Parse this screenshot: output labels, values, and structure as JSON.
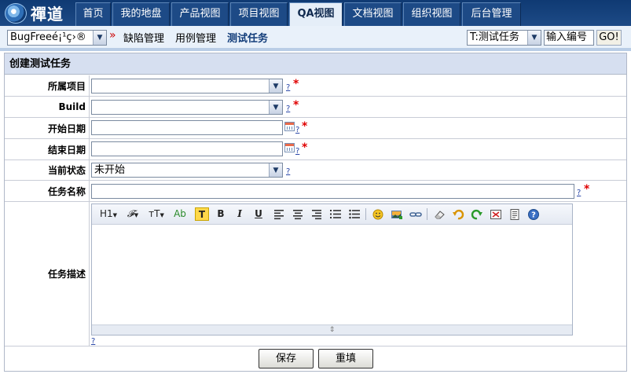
{
  "nav": {
    "logo_text": "禪道",
    "tabs": [
      {
        "label": "首页",
        "active": false
      },
      {
        "label": "我的地盘",
        "active": false
      },
      {
        "label": "产品视图",
        "active": false
      },
      {
        "label": "项目视图",
        "active": false
      },
      {
        "label": "QA视图",
        "active": true
      },
      {
        "label": "文档视图",
        "active": false
      },
      {
        "label": "组织视图",
        "active": false
      },
      {
        "label": "后台管理",
        "active": false
      }
    ]
  },
  "subnav": {
    "product_select": "BugFreeé¡¹ç›®",
    "separator": "»",
    "links": [
      "缺陷管理",
      "用例管理",
      "测试任务"
    ],
    "type_select": "T:测试任务",
    "id_input_value": "输入编号",
    "go_label": "GO!"
  },
  "form": {
    "title": "创建测试任务",
    "fields": {
      "project": {
        "label": "所属项目",
        "value": ""
      },
      "build": {
        "label": "Build",
        "value": ""
      },
      "begin": {
        "label": "开始日期",
        "value": ""
      },
      "end": {
        "label": "结束日期",
        "value": ""
      },
      "status": {
        "label": "当前状态",
        "value": "未开始"
      },
      "name": {
        "label": "任务名称",
        "value": ""
      },
      "desc": {
        "label": "任务描述"
      }
    },
    "help": "?",
    "required": "*",
    "editor_toolbar": [
      "H1",
      "𝓕",
      "тT",
      "Ab",
      "T",
      "B",
      "I",
      "U"
    ],
    "buttons": {
      "save": "保存",
      "reset": "重填"
    }
  },
  "colors": {
    "nav_bg": "#1d4a86",
    "active_tab_bg": "#e5eef8",
    "panel_header_bg": "#d6dff0",
    "required": "#e00000"
  }
}
